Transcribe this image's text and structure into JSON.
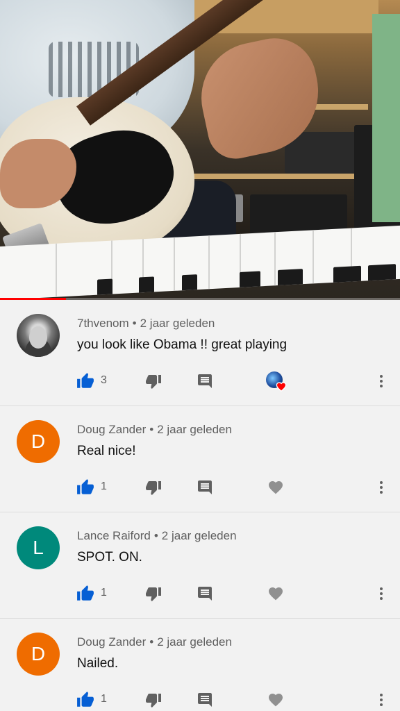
{
  "video": {
    "progress_fraction": 0.165,
    "progress_color": "#ff0000"
  },
  "comments": [
    {
      "author": "7thvenom",
      "time": "2 jaar geleden",
      "text": "you look like Obama !! great playing",
      "likes": "3",
      "avatar_type": "photo",
      "avatar_letter": "",
      "avatar_color": "",
      "creator_hearted": true
    },
    {
      "author": "Doug Zander",
      "time": "2 jaar geleden",
      "text": "Real nice!",
      "likes": "1",
      "avatar_type": "letter",
      "avatar_letter": "D",
      "avatar_color": "#ef6c00",
      "creator_hearted": false
    },
    {
      "author": "Lance Raiford",
      "time": "2 jaar geleden",
      "text": "SPOT. ON.",
      "likes": "1",
      "avatar_type": "letter",
      "avatar_letter": "L",
      "avatar_color": "#00897b",
      "creator_hearted": false
    },
    {
      "author": "Doug Zander",
      "time": "2 jaar geleden",
      "text": "Nailed.",
      "likes": "1",
      "avatar_type": "letter",
      "avatar_letter": "D",
      "avatar_color": "#ef6c00",
      "creator_hearted": false
    }
  ],
  "icons": {
    "like": "thumb-up-icon",
    "dislike": "thumb-down-icon",
    "reply": "reply-icon",
    "heart": "heart-icon",
    "more": "more-vert-icon"
  },
  "colors": {
    "like_blue": "#065fd4",
    "icon_gray": "#606060",
    "heart_gray": "#909090",
    "creator_heart_red": "#ff0000"
  }
}
